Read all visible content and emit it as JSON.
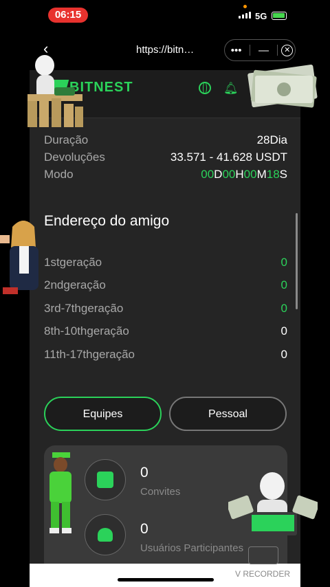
{
  "status_bar": {
    "time": "06:15",
    "network": "5G"
  },
  "browser": {
    "back_glyph": "‹",
    "url": "https://bitn…",
    "menu_glyph": "•••",
    "minimize_glyph": "—",
    "close_glyph": "✕"
  },
  "app": {
    "logo_text": "BITNEST",
    "accent": "#2bd25a"
  },
  "info": [
    {
      "label": "Duração",
      "value": "28Dia"
    },
    {
      "label": "Devoluções",
      "value": "33.571 - 41.628 USDT"
    }
  ],
  "mode": {
    "label": "Modo",
    "d_val": "00",
    "d_unit": "D",
    "h_val": "00",
    "h_unit": "H",
    "m_val": "00",
    "m_unit": "M",
    "s_val": "18",
    "s_unit": "S"
  },
  "friends": {
    "title": "Endereço do amigo",
    "generations": [
      {
        "label": "1stgeração",
        "count": "0"
      },
      {
        "label": "2ndgeração",
        "count": "0"
      },
      {
        "label": "3rd-7thgeração",
        "count": "0"
      },
      {
        "label": "8th-10thgeração",
        "count": "0"
      },
      {
        "label": "11th-17thgeração",
        "count": "0"
      }
    ]
  },
  "tabs": {
    "teams": "Equipes",
    "personal": "Pessoal"
  },
  "stats": {
    "invites": {
      "value": "0",
      "label": "Convites"
    },
    "participants": {
      "value": "0",
      "label": "Usuários Participantes"
    }
  },
  "watermark": {
    "recorder": "V RECORDER"
  }
}
